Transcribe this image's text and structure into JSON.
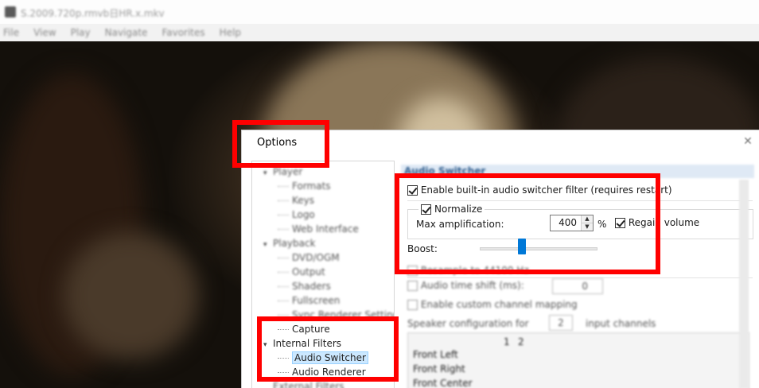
{
  "player": {
    "title": "S.2009.720p.rmvb日HR.x.mkv",
    "menu": [
      "File",
      "View",
      "Play",
      "Navigate",
      "Favorites",
      "Help"
    ]
  },
  "dialog": {
    "title": "Options",
    "close_glyph": "✕",
    "tree": [
      {
        "label": "Player",
        "level": 0,
        "expander": "▾",
        "blurred": true
      },
      {
        "label": "Formats",
        "level": 1,
        "blurred": true
      },
      {
        "label": "Keys",
        "level": 1,
        "blurred": true
      },
      {
        "label": "Logo",
        "level": 1,
        "blurred": true
      },
      {
        "label": "Web Interface",
        "level": 1,
        "blurred": true
      },
      {
        "label": "Playback",
        "level": 0,
        "expander": "▾",
        "blurred": true
      },
      {
        "label": "DVD/OGM",
        "level": 1,
        "blurred": true
      },
      {
        "label": "Output",
        "level": 1,
        "blurred": true
      },
      {
        "label": "Shaders",
        "level": 1,
        "blurred": true
      },
      {
        "label": "Fullscreen",
        "level": 1,
        "blurred": true
      },
      {
        "label": "Sync Renderer Settings",
        "level": 1,
        "blurred": true
      },
      {
        "label": "Capture",
        "level": 1,
        "blurred": false
      },
      {
        "label": "Internal Filters",
        "level": 0,
        "expander": "▾",
        "blurred": false
      },
      {
        "label": "Audio Switcher",
        "level": 1,
        "blurred": false,
        "selected": true
      },
      {
        "label": "Audio Renderer",
        "level": 1,
        "blurred": false
      },
      {
        "label": "External Filters",
        "level": 0,
        "blurred": true
      }
    ],
    "section_title": "Audio Switcher",
    "enable_switcher": {
      "label": "Enable built-in audio switcher filter (requires restart)",
      "checked": true
    },
    "normalize": {
      "label": "Normalize",
      "checked": true
    },
    "max_amp": {
      "label": "Max amplification:",
      "value": "400",
      "unit": "%"
    },
    "regain": {
      "label": "Regain volume",
      "checked": true
    },
    "boost": {
      "label": "Boost:",
      "level_fraction": 0.36
    },
    "resample": {
      "label": "Resample to 44100 Hz",
      "checked": false
    },
    "time_shift": {
      "label": "Audio time shift (ms):",
      "value": "0",
      "checked": false
    },
    "channel_mapping": {
      "label": "Enable custom channel mapping",
      "checked": false
    },
    "speaker_config": {
      "label": "Speaker configuration for",
      "value": "2",
      "suffix": "input channels"
    },
    "speaker_table": {
      "columns": [
        "1",
        "2"
      ],
      "rows": [
        "Front Left",
        "Front Right",
        "Front Center"
      ]
    }
  }
}
